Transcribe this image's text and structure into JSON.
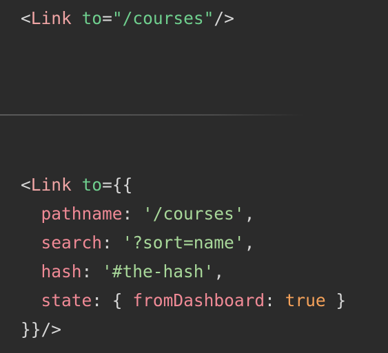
{
  "colors": {
    "background": "#2b2b2b",
    "punctuation": "#d6d6d6",
    "tag": "#f0a5a5",
    "attribute": "#6fcf8e",
    "string": "#a8d89a",
    "key": "#f08a96",
    "boolean": "#f5a25a",
    "divider": "#4c4c4c"
  },
  "snippet_1": {
    "open": "<",
    "tag": "Link",
    "space": " ",
    "attr": "to",
    "eq": "=",
    "value": "\"/courses\"",
    "close": "/>"
  },
  "snippet_2": {
    "line1": {
      "open": "<",
      "tag": "Link",
      "space": " ",
      "attr": "to",
      "eq_brace": "={{"
    },
    "line2": {
      "indent": "  ",
      "key": "pathname",
      "colon": ": ",
      "value": "'/courses'",
      "comma": ","
    },
    "line3": {
      "indent": "  ",
      "key": "search",
      "colon": ": ",
      "value": "'?sort=name'",
      "comma": ","
    },
    "line4": {
      "indent": "  ",
      "key": "hash",
      "colon": ": ",
      "value": "'#the-hash'",
      "comma": ","
    },
    "line5": {
      "indent": "  ",
      "key": "state",
      "colon": ": ",
      "brace_open": "{ ",
      "inner_key": "fromDashboard",
      "inner_colon": ": ",
      "inner_value": "true",
      "brace_close": " }"
    },
    "line6": {
      "close": "}}/>"
    }
  }
}
